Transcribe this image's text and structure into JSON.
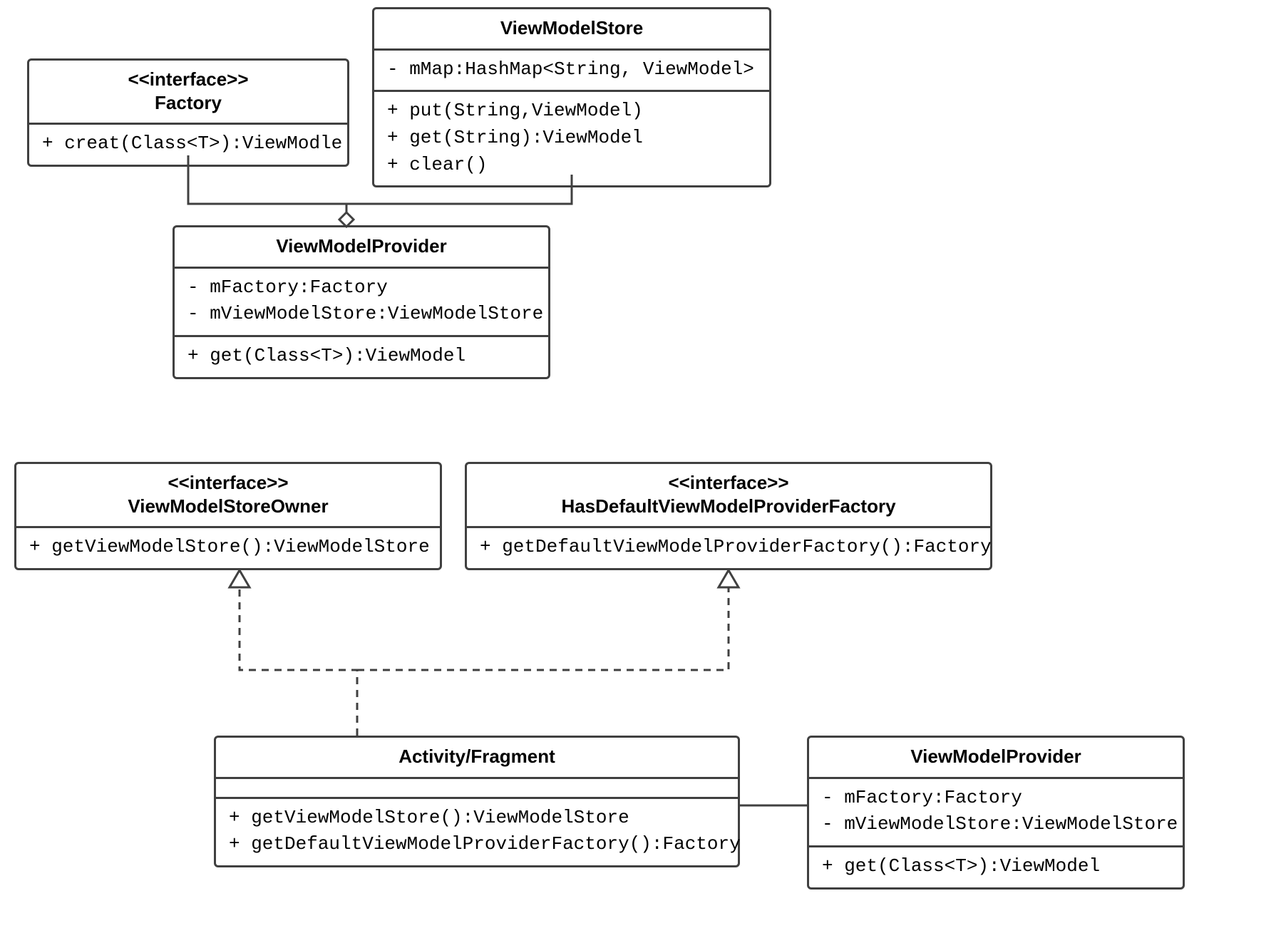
{
  "classes": {
    "factory": {
      "stereotype": "<<interface>>",
      "name": "Factory",
      "methods": [
        "+ creat(Class<T>):ViewModle"
      ]
    },
    "viewModelStore": {
      "name": "ViewModelStore",
      "fields": [
        "- mMap:HashMap<String, ViewModel>"
      ],
      "methods": [
        "+ put(String,ViewModel)",
        "+ get(String):ViewModel",
        "+ clear()"
      ]
    },
    "viewModelProvider": {
      "name": "ViewModelProvider",
      "fields": [
        "- mFactory:Factory",
        "- mViewModelStore:ViewModelStore"
      ],
      "methods": [
        "+ get(Class<T>):ViewModel"
      ]
    },
    "viewModelStoreOwner": {
      "stereotype": "<<interface>>",
      "name": "ViewModelStoreOwner",
      "methods": [
        "+ getViewModelStore():ViewModelStore"
      ]
    },
    "hasDefaultFactory": {
      "stereotype": "<<interface>>",
      "name": "HasDefaultViewModelProviderFactory",
      "methods": [
        "+ getDefaultViewModelProviderFactory():Factory"
      ]
    },
    "activityFragment": {
      "name": "Activity/Fragment",
      "methods": [
        "+ getViewModelStore():ViewModelStore",
        "+ getDefaultViewModelProviderFactory():Factory"
      ]
    },
    "viewModelProvider2": {
      "name": "ViewModelProvider",
      "fields": [
        "- mFactory:Factory",
        "- mViewModelStore:ViewModelStore"
      ],
      "methods": [
        "+ get(Class<T>):ViewModel"
      ]
    }
  },
  "relationships": [
    {
      "from": "factory",
      "to": "viewModelProvider",
      "type": "aggregation"
    },
    {
      "from": "viewModelStore",
      "to": "viewModelProvider",
      "type": "aggregation"
    },
    {
      "from": "activityFragment",
      "to": "viewModelStoreOwner",
      "type": "realization"
    },
    {
      "from": "activityFragment",
      "to": "hasDefaultFactory",
      "type": "realization"
    },
    {
      "from": "activityFragment",
      "to": "viewModelProvider2",
      "type": "association"
    }
  ]
}
